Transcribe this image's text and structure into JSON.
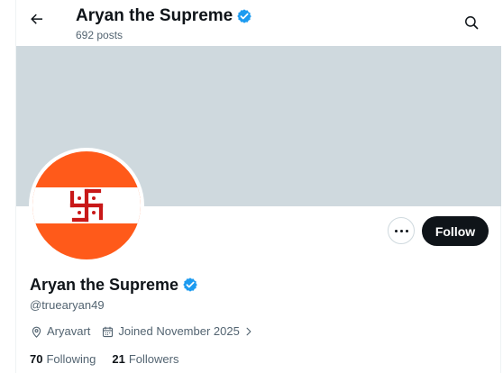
{
  "header": {
    "name": "Aryan the Supreme",
    "posts": "692 posts",
    "back_icon": "arrow-left-icon",
    "search_icon": "search-icon"
  },
  "profile": {
    "name": "Aryan the Supreme",
    "handle": "@truearyan49",
    "location": "Aryavart",
    "joined": "Joined November 2025",
    "verified_color": "#1d9bf0",
    "following_count": "70",
    "following_label": "Following",
    "followers_count": "21",
    "followers_label": "Followers"
  },
  "actions": {
    "follow_label": "Follow",
    "more_icon": "more-horizontal-icon"
  },
  "colors": {
    "banner": "#cfd9de",
    "avatar_orange": "#ff5a1a",
    "avatar_symbol": "#c81818",
    "follow_button": "#0f1419"
  }
}
